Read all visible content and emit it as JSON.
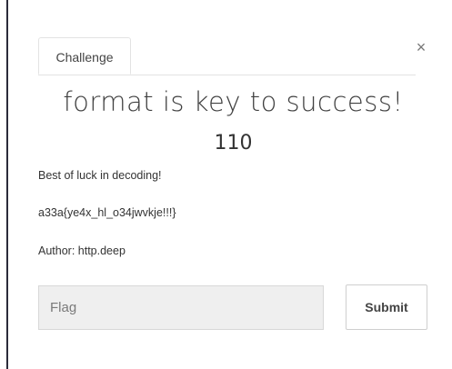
{
  "modal": {
    "tab_label": "Challenge",
    "close_glyph": "×",
    "challenge_name": "format is key to success!",
    "points": "110",
    "description_lines": [
      "Best of luck in decoding!",
      "a33a{ye4x_hl_o34jwvkje!!!}",
      "Author: http.deep"
    ],
    "flag_input": {
      "value": "",
      "placeholder": "Flag"
    },
    "submit_label": "Submit"
  },
  "colors": {
    "input_background": "#efefef",
    "border": "#e3e3e3",
    "text": "#333333"
  }
}
